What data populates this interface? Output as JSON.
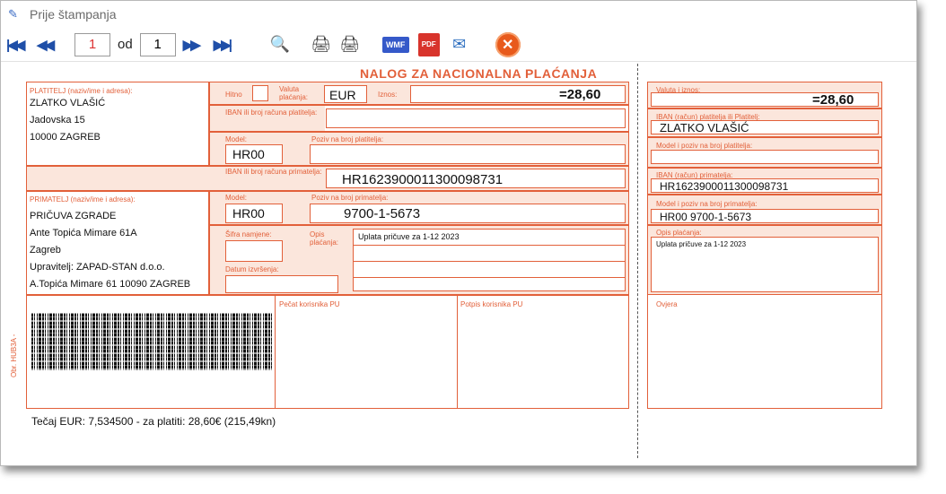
{
  "window": {
    "title": "Prije štampanja"
  },
  "toolbar": {
    "current_page": "1",
    "of_label": "od",
    "total_pages": "1",
    "wmf_label": "WMF",
    "pdf_label": "PDF"
  },
  "form": {
    "title": "NALOG ZA NACIONALNA PLAĆANJA",
    "payer_label": "PLATITELJ (naziv/ime i adresa):",
    "payer_lines": [
      "ZLATKO VLAŠIĆ",
      "Jadovska 15",
      "10000 ZAGREB"
    ],
    "hitno_label": "Hitno",
    "currency_label": "Valuta plaćanja:",
    "currency": "EUR",
    "amount_label": "Iznos:",
    "amount": "=28,60",
    "payer_iban_label": "IBAN ili broj računa platitelja:",
    "model_label": "Model:",
    "payer_ref_label": "Poziv na broj platitelja:",
    "payer_model": "HR00",
    "recipient_iban_label": "IBAN ili broj računa primatelja:",
    "recipient_iban": "HR1623900011300098731",
    "recipient_label": "PRIMATELJ (naziv/ime i adresa):",
    "recipient_lines": [
      "PRIČUVA ZGRADE",
      "Ante Topića Mimare 61A",
      "Zagreb",
      "Upravitelj: ZAPAD-STAN d.o.o.",
      "A.Topića Mimare 61 10090 ZAGREB"
    ],
    "recipient_model_label": "Model:",
    "recipient_model": "HR00",
    "recipient_ref_label": "Poziv na broj primatelja:",
    "recipient_ref": "9700-1-5673",
    "sifra_label": "Šifra namjene:",
    "opis_label": "Opis plaćanja:",
    "opis": "Uplata pričuve za 1-12 2023",
    "datum_label": "Datum izvršenja:",
    "pecat_label": "Pečat korisnika PU",
    "potpis_label": "Potpis korisnika PU",
    "side_label": "Obr. HUB3A -",
    "tecaj": "Tečaj EUR: 7,534500 - za platiti: 28,60€ (215,49kn)"
  },
  "receipt": {
    "amount_label": "Valuta i iznos:",
    "amount": "=28,60",
    "payer_iban_label": "IBAN (račun) platitelja ili Platitelj:",
    "payer_name": "ZLATKO VLAŠIĆ",
    "payer_ref_label": "Model i poziv na broj platitelja:",
    "recipient_iban_label": "IBAN (račun) primatelja:",
    "recipient_iban": "HR1623900011300098731",
    "recipient_ref_label": "Model i poziv na broj primatelja:",
    "recipient_ref": "HR00   9700-1-5673",
    "opis_label": "Opis plaćanja:",
    "opis": "Uplata pričuve za 1-12 2023",
    "ovjera_label": "Ovjera"
  }
}
